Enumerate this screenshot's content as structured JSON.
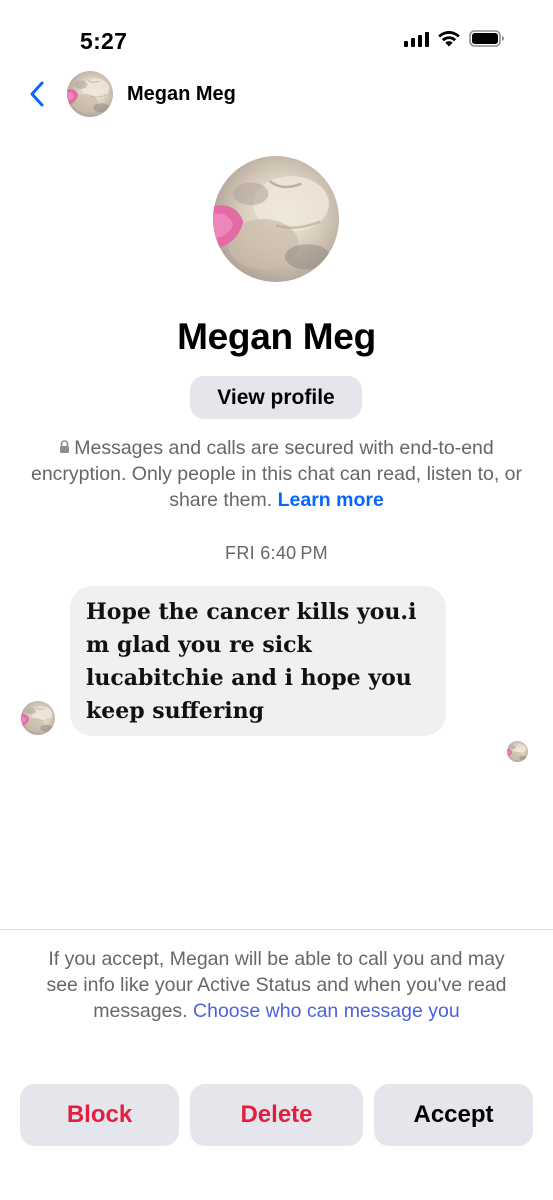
{
  "status_bar": {
    "time": "5:27"
  },
  "header": {
    "contact_name": "Megan Meg"
  },
  "profile": {
    "name": "Megan Meg",
    "view_profile_label": "View profile"
  },
  "encryption_notice": {
    "text": "Messages and calls are secured with end-to-end encryption. Only people in this chat can read, listen to, or share them.",
    "link_label": "Learn more"
  },
  "conversation": {
    "timestamp": "FRI 6:40 PM",
    "messages": [
      {
        "sender": "Megan Meg",
        "text": "Hope the cancer kills you.i m glad you re sick lucabitchie and i hope you keep suffering"
      }
    ]
  },
  "request_panel": {
    "note": "If you accept, Megan will be able to call you and may see info like your Active Status and when you've read messages.",
    "link_label": "Choose who can message you",
    "block_label": "Block",
    "delete_label": "Delete",
    "accept_label": "Accept"
  },
  "colors": {
    "link_blue": "#0866ff",
    "choose_link": "#4b63d9",
    "destructive_red": "#e41e3f",
    "button_gray": "#e4e6eb",
    "bubble_gray": "#f0f0f0",
    "secondary_text": "#65676b"
  },
  "icons": {
    "back": "chevron-left-icon",
    "lock": "lock-icon",
    "signal": "cellular-signal-icon",
    "wifi": "wifi-icon",
    "battery": "battery-icon"
  }
}
